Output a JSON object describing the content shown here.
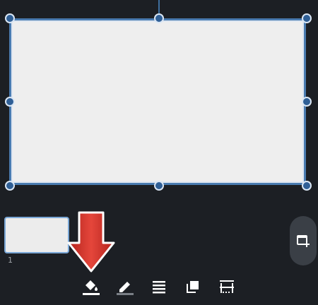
{
  "canvas": {
    "shape_fill": "#eeeeee",
    "selection_color": "#4a7bb0"
  },
  "slides": [
    {
      "number": "1",
      "thumb_fill": "#ececec",
      "selected": true
    }
  ],
  "side_button": {
    "icon": "add-slide-icon"
  },
  "annotation": {
    "icon": "red-down-arrow",
    "color": "#d8322b"
  },
  "toolbar": {
    "tools": [
      {
        "name": "fill-color",
        "icon": "paint-bucket-icon"
      },
      {
        "name": "line-color",
        "icon": "pencil-icon"
      },
      {
        "name": "line-style",
        "icon": "lines-icon"
      },
      {
        "name": "arrange",
        "icon": "layers-icon"
      },
      {
        "name": "wrap",
        "icon": "wrap-text-icon"
      }
    ]
  }
}
